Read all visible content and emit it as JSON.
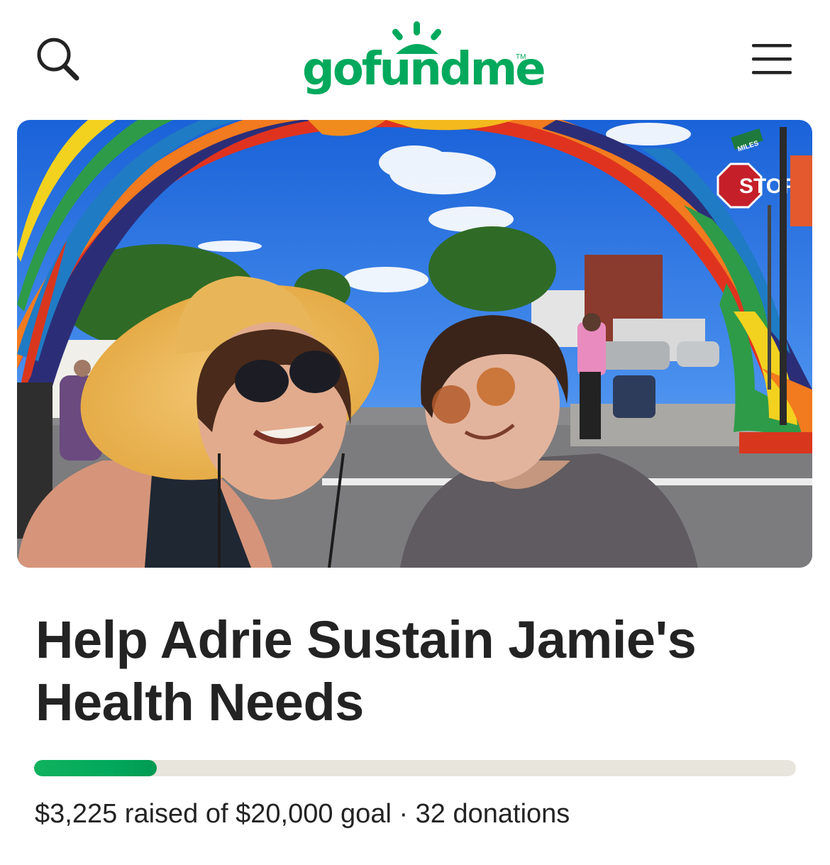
{
  "header": {
    "logo_text": "gofundme",
    "logo_tm": "TM",
    "search_icon": "search-icon",
    "menu_icon": "hamburger-menu-icon"
  },
  "campaign": {
    "title": "Help Adrie Sustain Jamie's Health Needs",
    "hero_image": {
      "sign_text": "STOP",
      "street_sign_text": "MILES"
    },
    "raised": "$3,225",
    "raised_label": "raised of",
    "goal": "$20,000",
    "goal_label": "goal",
    "separator": "·",
    "donations": "32 donations",
    "progress_fraction": 0.16125
  },
  "colors": {
    "brand_green": "#02a95c",
    "track": "#e8e5dd",
    "text": "#232323"
  }
}
